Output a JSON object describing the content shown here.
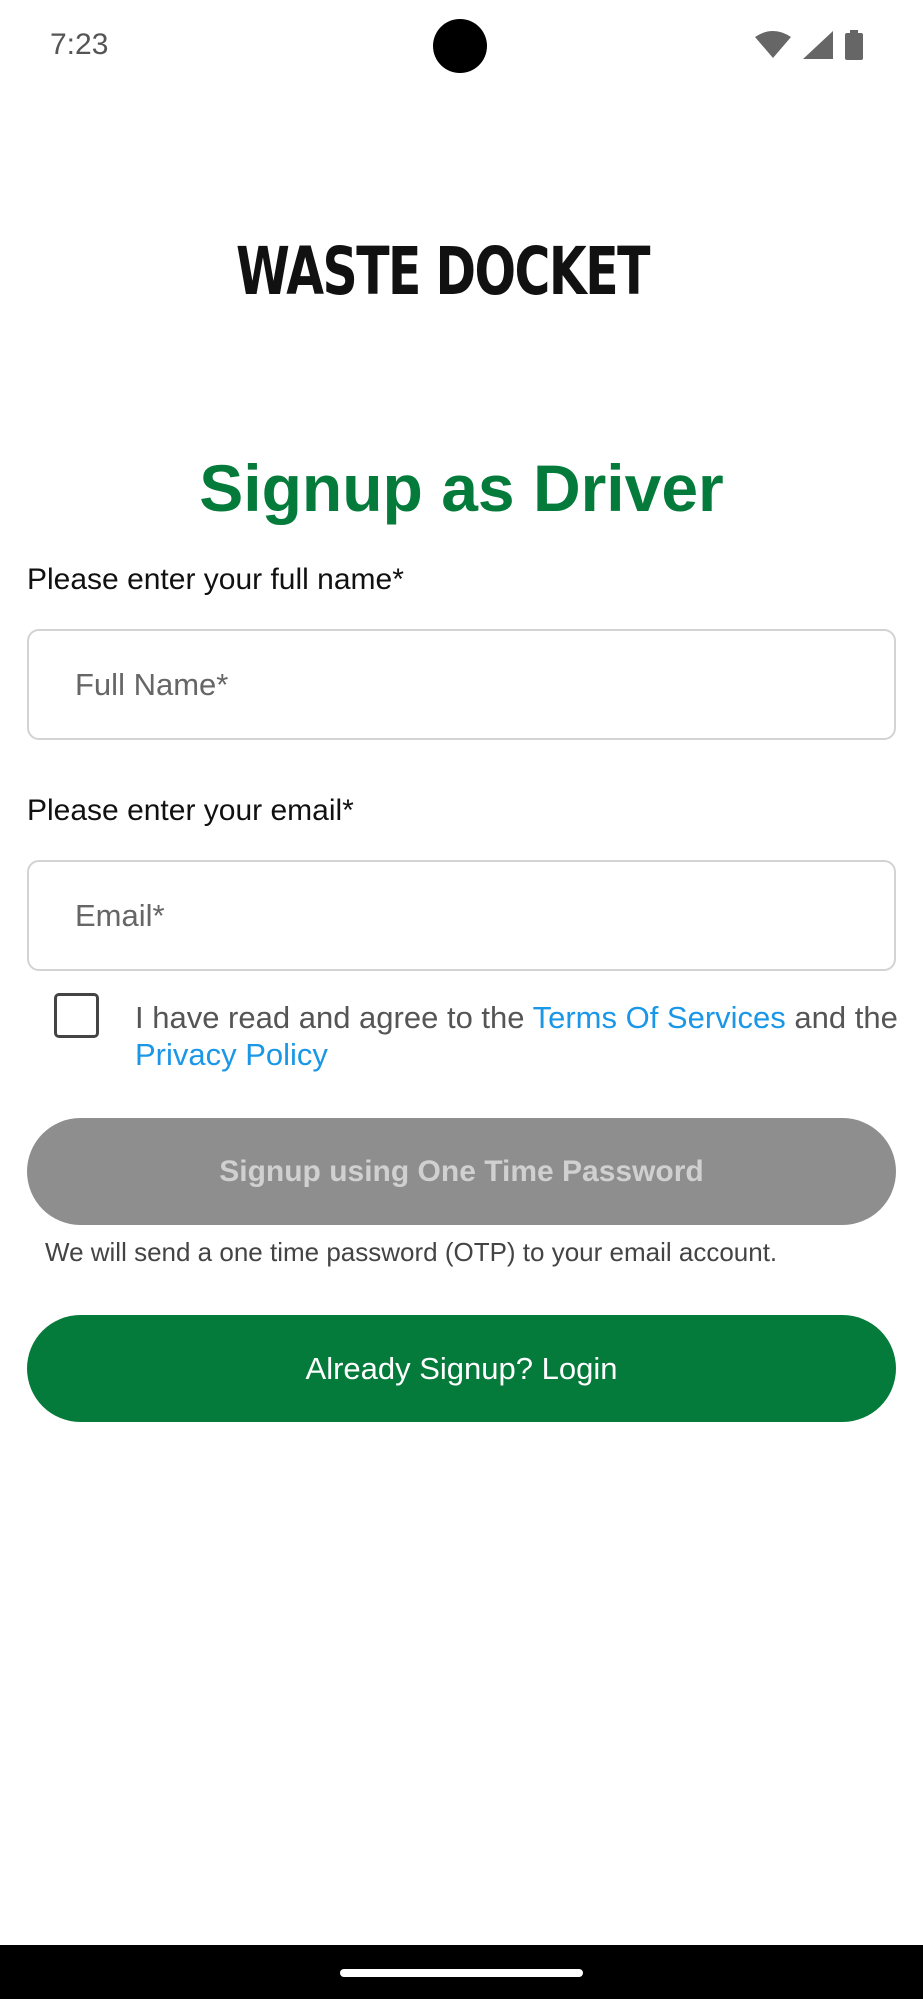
{
  "status_bar": {
    "time": "7:23",
    "icons": [
      "wifi-icon",
      "signal-icon",
      "battery-icon"
    ]
  },
  "logo": {
    "text": "WASTE DOCKET",
    "icon": "clipboard-trash-icon"
  },
  "title": "Signup as Driver",
  "name_field": {
    "label": "Please enter your full name*",
    "placeholder": "Full Name*",
    "value": ""
  },
  "email_field": {
    "label": "Please enter your email*",
    "placeholder": "Email*",
    "value": ""
  },
  "agreement": {
    "checked": false,
    "text_1": "I have read and agree to the ",
    "terms_link": "Terms Of Services",
    "text_2": " and the  ",
    "privacy_link": "Privacy Policy"
  },
  "otp_button": {
    "label": "Signup using One Time Password",
    "enabled": false
  },
  "otp_note": "We will send a one time password (OTP) to your email account.",
  "login_button": {
    "label": "Already Signup? Login"
  },
  "colors": {
    "brand_green": "#047a3b",
    "link_blue": "#1a97e6",
    "disabled_gray": "#8e8e8e"
  }
}
